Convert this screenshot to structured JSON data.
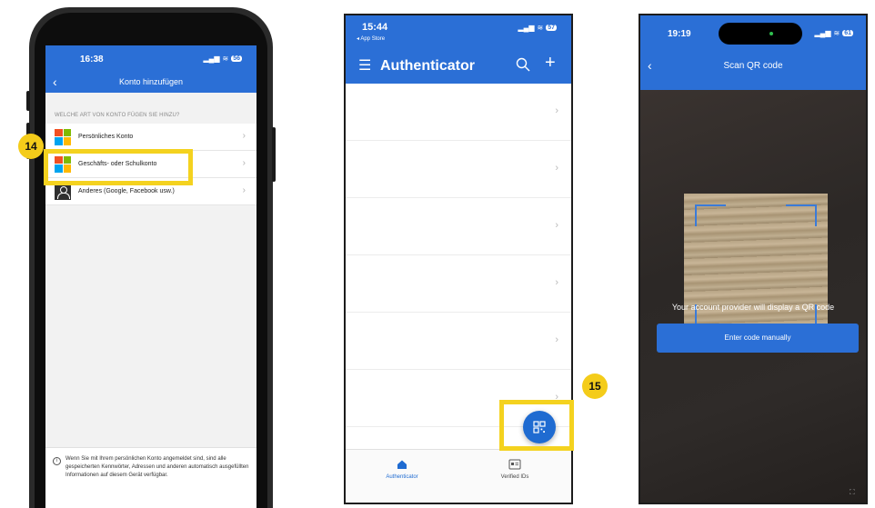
{
  "phone1": {
    "status": {
      "time": "16:38",
      "battery": "56"
    },
    "header": {
      "title": "Konto hinzufügen"
    },
    "section_label": "WELCHE ART VON KONTO FÜGEN SIE HINZU?",
    "accounts": [
      {
        "label": "Persönliches Konto",
        "icon": "microsoft-logo"
      },
      {
        "label": "Geschäfts- oder Schulkonto",
        "icon": "microsoft-logo"
      },
      {
        "label": "Anderes (Google, Facebook usw.)",
        "icon": "person-icon"
      }
    ],
    "footer_note": "Wenn Sie mit Ihrem persönlichen Konto angemeldet sind, sind alle gespeicherten Kennwörter, Adressen und anderen automatisch ausgefüllten Informationen auf diesem Gerät verfügbar."
  },
  "phone2": {
    "status": {
      "time": "15:44",
      "back_app": "◂ App Store",
      "battery": "57"
    },
    "header": {
      "title": "Authenticator"
    },
    "list_row_count": 7,
    "tabs": [
      {
        "label": "Authenticator",
        "icon": "home-icon",
        "active": true
      },
      {
        "label": "Verified IDs",
        "icon": "id-card-icon",
        "active": false
      }
    ]
  },
  "phone3": {
    "status": {
      "time": "19:19",
      "battery": "61"
    },
    "header": {
      "title": "Scan QR code"
    },
    "caption": "Your account provider will display a QR code",
    "button_label": "Enter code manually"
  },
  "callouts": [
    {
      "number": "14"
    },
    {
      "number": "15"
    }
  ],
  "colors": {
    "accent_blue": "#2b6fd6",
    "highlight_yellow": "#f4d21f",
    "ms_red": "#f25022",
    "ms_green": "#7fba00",
    "ms_blue": "#00a4ef",
    "ms_yellow": "#ffb900"
  }
}
